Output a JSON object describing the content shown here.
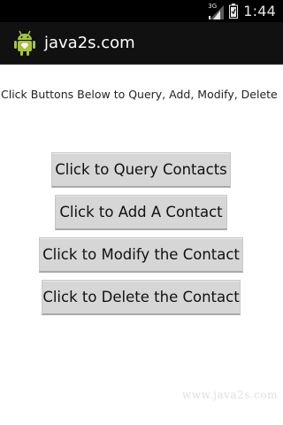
{
  "status_bar": {
    "network_type": "3G",
    "time": "1:44"
  },
  "action_bar": {
    "title": "java2s.com",
    "icon": "android-robot-icon"
  },
  "main": {
    "instructions": "Click Buttons Below to Query, Add, Modify, Delete",
    "buttons": {
      "query": "Click to Query Contacts",
      "add": "Click to Add A Contact",
      "modify": "Click to Modify the Contact",
      "delete": "Click to Delete the Contact"
    }
  },
  "watermark": "www.java2s.com",
  "colors": {
    "status_bar_bg": "#000000",
    "action_bar_bg": "#111111",
    "button_bg": "#d6d6d6",
    "android_green": "#a4c639"
  }
}
